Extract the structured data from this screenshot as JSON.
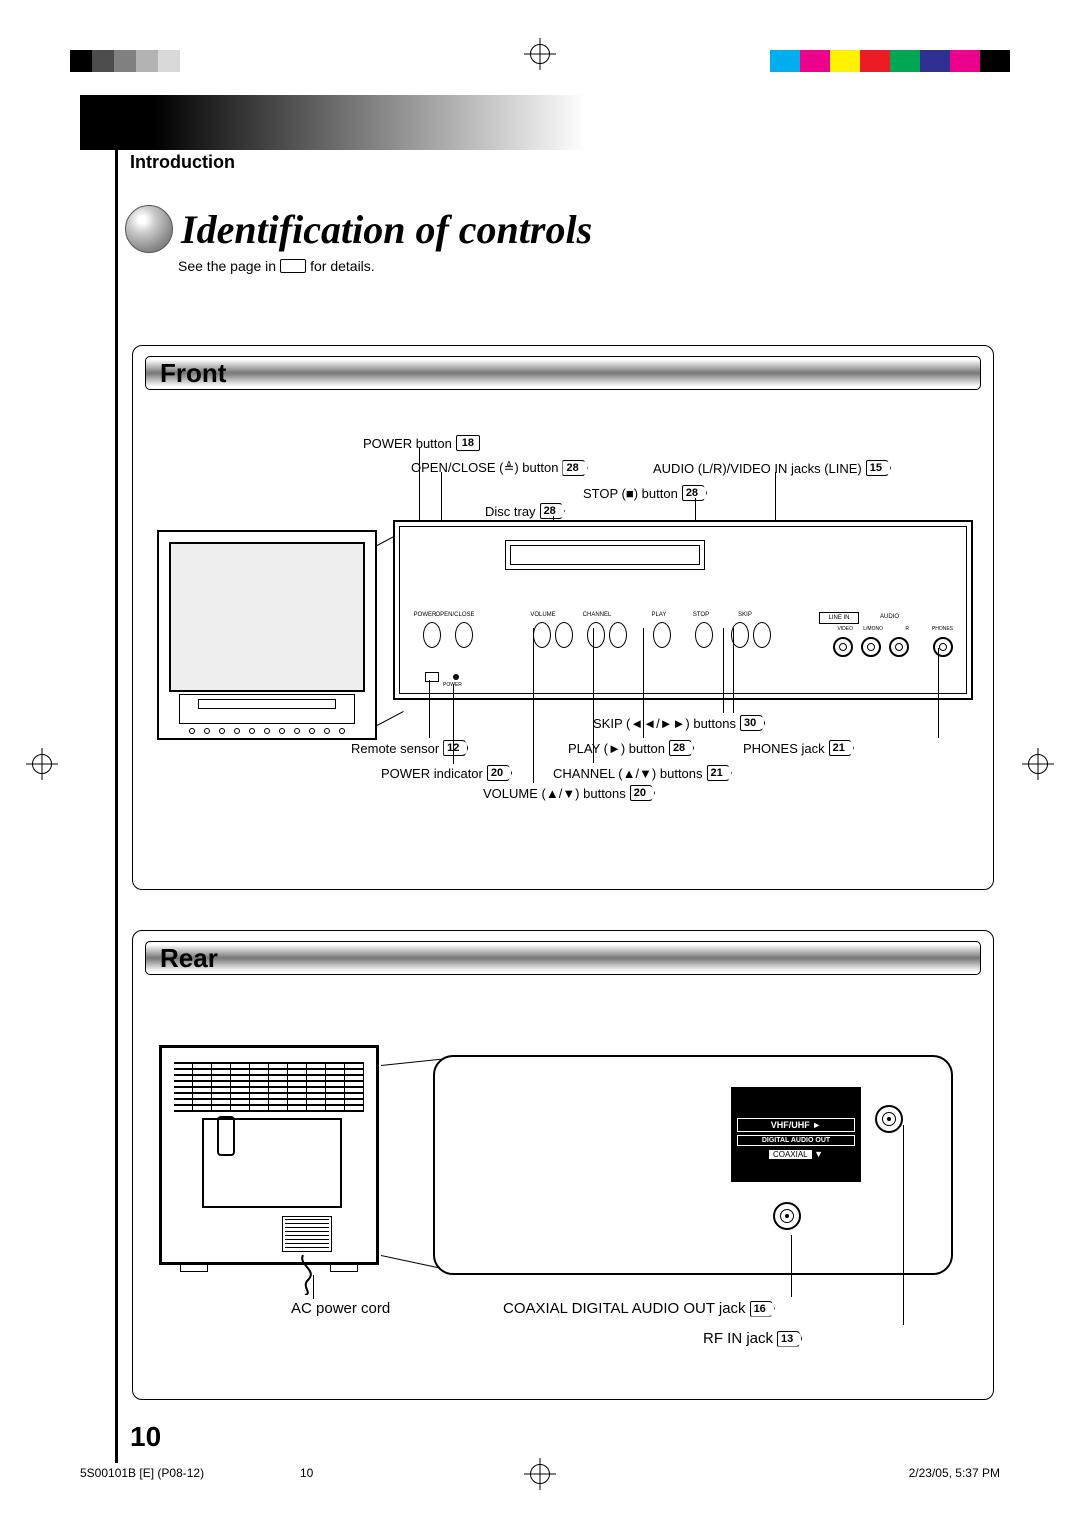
{
  "section_label": "Introduction",
  "title": "Identification of controls",
  "subtitle_pre": "See the page in",
  "subtitle_post": "for details.",
  "page_number": "10",
  "front": {
    "heading": "Front",
    "labels": {
      "power_button": "POWER button",
      "open_close": "OPEN/CLOSE (≜) button",
      "audio_video_in": "AUDIO (L/R)/VIDEO IN jacks (LINE)",
      "stop": "STOP (■) button",
      "disc_tray": "Disc tray",
      "remote_sensor": "Remote sensor",
      "power_indicator": "POWER indicator",
      "volume": "VOLUME (▲/▼) buttons",
      "channel": "CHANNEL (▲/▼) buttons",
      "play": "PLAY (►) button",
      "skip": "SKIP (◄◄/►►) buttons",
      "phones": "PHONES jack"
    },
    "refs": {
      "power_button": "18",
      "open_close": "28",
      "audio_video_in": "15",
      "stop": "28",
      "disc_tray": "28",
      "remote_sensor": "12",
      "power_indicator": "20",
      "volume": "20",
      "channel": "21",
      "play": "28",
      "skip": "30",
      "phones": "21"
    },
    "panel_tiny": {
      "power": "POWER",
      "open_close": "OPEN/CLOSE",
      "volume": "VOLUME",
      "channel": "CHANNEL",
      "play": "PLAY",
      "stop": "STOP",
      "skip": "SKIP",
      "line_in": "LINE IN",
      "video": "VIDEO",
      "audio": "AUDIO",
      "lmono": "L/MONO",
      "r": "R",
      "phones": "PHONES",
      "power_led": "POWER"
    }
  },
  "rear": {
    "heading": "Rear",
    "labels": {
      "ac_cord": "AC power cord",
      "coaxial": "COAXIAL DIGITAL AUDIO OUT jack",
      "rf_in": "RF IN jack"
    },
    "refs": {
      "coaxial": "16",
      "rf_in": "13"
    },
    "panel": {
      "vhf_uhf": "VHF/UHF ►",
      "digital_out": "DIGITAL AUDIO OUT",
      "coaxial_tag": "COAXIAL",
      "arrow_down": "▼"
    }
  },
  "footer": {
    "doc": "5S00101B [E] (P08-12)",
    "page": "10",
    "date": "2/23/05, 5:37 PM"
  },
  "colors": {
    "cyan": "#00AEEF",
    "magenta": "#EC008C",
    "yellow": "#FFF200",
    "red": "#ED1C24",
    "green": "#00A651",
    "blue": "#2E3192"
  }
}
